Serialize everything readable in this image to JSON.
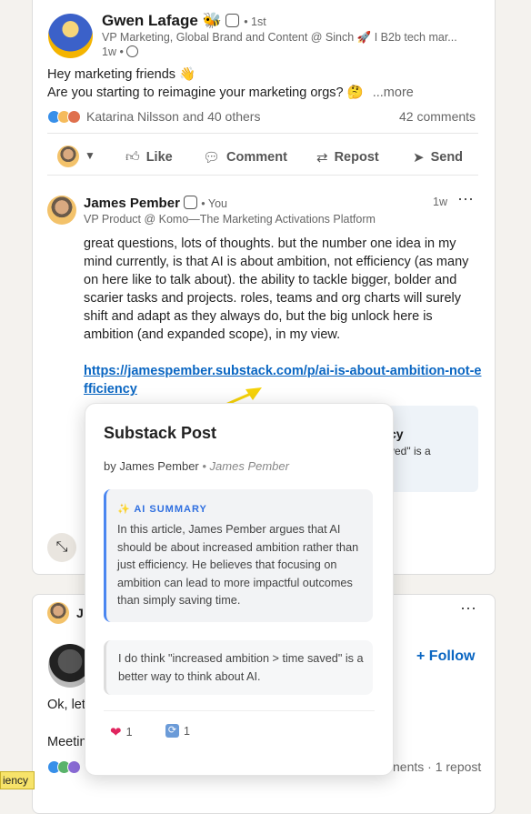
{
  "post": {
    "author_name": "Gwen Lafage",
    "author_emoji": "🐝",
    "connection": "• 1st",
    "headline": "VP Marketing, Global Brand and Content @ Sinch 🚀 I B2b tech mar...",
    "age": "1w •",
    "text_line1": "Hey marketing friends 👋",
    "text_line2": "Are you starting to reimagine your marketing orgs? 🤔",
    "more": "...more",
    "reactions_text": "Katarina Nilsson and 40 others",
    "comments_count": "42 comments",
    "actions": {
      "like": "Like",
      "comment": "Comment",
      "repost": "Repost",
      "send": "Send"
    }
  },
  "comment": {
    "author_name": "James Pember",
    "you_label": "• You",
    "headline": "VP Product @ Komo—The Marketing Activations Platform",
    "age": "1w",
    "more_icon": "⋯",
    "body": "great questions, lots of thoughts. but the number one idea in my mind currently, is that AI is about ambition, not efficiency (as many on here like to talk about). the ability to tackle bigger, bolder and scarier tasks and projects. roles, teams and org charts will surely shift and adapt as they always do, but the big unlock here is ambition (and expanded scope), in my view.",
    "link": "https://jamespember.substack.com/p/ai-is-about-ambition-not-efficiency",
    "preview_title_fragment": "cy",
    "preview_sub_fragment": "ved\" is a"
  },
  "popup": {
    "title": "Substack Post",
    "by": "by James Pember",
    "author": "• James Pember",
    "summary_label": "✨ AI SUMMARY",
    "summary_text": "In this article, James Pember argues that AI should be about increased ambition rather than just efficiency. He believes that focusing on ambition can lead to more impactful outcomes than simply saving time.",
    "quote": "I do think \"increased ambition > time saved\" is a better way to think about AI.",
    "heart_count": "1",
    "repost_count": "1"
  },
  "second_card": {
    "name_fragment": "J",
    "more_icon": "⋯",
    "follow": "+ Follow",
    "text_fragment1": "Ok, let",
    "text_fragment2": "Meetin",
    "stats_fragment": "nents · 1 repost"
  },
  "tooltip": "iency",
  "colors": {
    "link": "#0a66c2",
    "accent": "#4a86f0",
    "tooltip_bg": "#f7e36a",
    "arrow": "#f5d20a"
  }
}
